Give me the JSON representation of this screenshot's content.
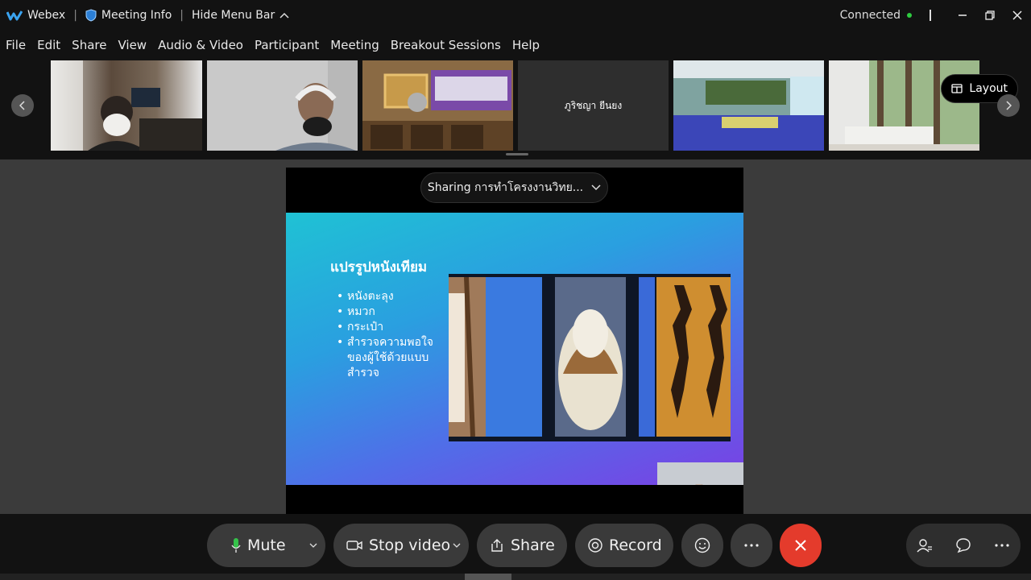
{
  "titlebar": {
    "app_name": "Webex",
    "meeting_info": "Meeting Info",
    "hide_menu": "Hide Menu Bar",
    "status": "Connected"
  },
  "menu": [
    "File",
    "Edit",
    "Share",
    "View",
    "Audio & Video",
    "Participant",
    "Meeting",
    "Breakout Sessions",
    "Help"
  ],
  "filmstrip": {
    "participant_name_tile4": "ภูริชญา ยีนยง",
    "layout_label": "Layout"
  },
  "share": {
    "sharing_label": "Sharing การทำโครงงานวิทย...",
    "slide_title": "แปรรูปหนังเทียม",
    "bullets": [
      "หนังตะลุง",
      "หมวก",
      "กระเป๋า",
      "สำรวจความพอใจของผู้ใช้ด้วยแบบสำรวจ"
    ]
  },
  "controls": {
    "mute": "Mute",
    "stop_video": "Stop video",
    "share": "Share",
    "record": "Record"
  },
  "colors": {
    "end_call": "#e43b2c",
    "connected_dot": "#2ecc40"
  }
}
